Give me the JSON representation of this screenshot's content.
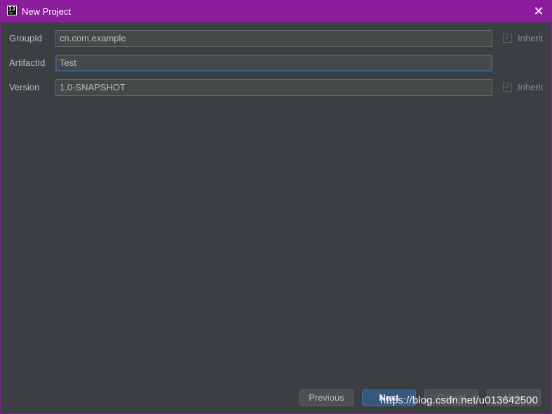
{
  "window": {
    "title": "New Project",
    "close_glyph": "✕",
    "icon": "intellij-idea-icon",
    "icon_glyph": "IJ"
  },
  "fields": [
    {
      "label": "GroupId",
      "value": "cn.com.example",
      "inherit": "Inherit",
      "inherit_checked": true
    },
    {
      "label": "ArtifactId",
      "value": "Test",
      "focused": true
    },
    {
      "label": "Version",
      "value": "1.0-SNAPSHOT",
      "inherit": "Inherit",
      "inherit_checked": true
    }
  ],
  "buttons": {
    "previous": "Previous",
    "next": "Next",
    "cancel": "Cancel",
    "help": "Help"
  },
  "watermark": "https://blog.csdn.net/u013642500",
  "colors": {
    "titlebar": "#8b1d9c",
    "background": "#3c3f41",
    "field_bg": "#45494a",
    "focus_border": "#3d6185",
    "primary_button": "#365880"
  }
}
